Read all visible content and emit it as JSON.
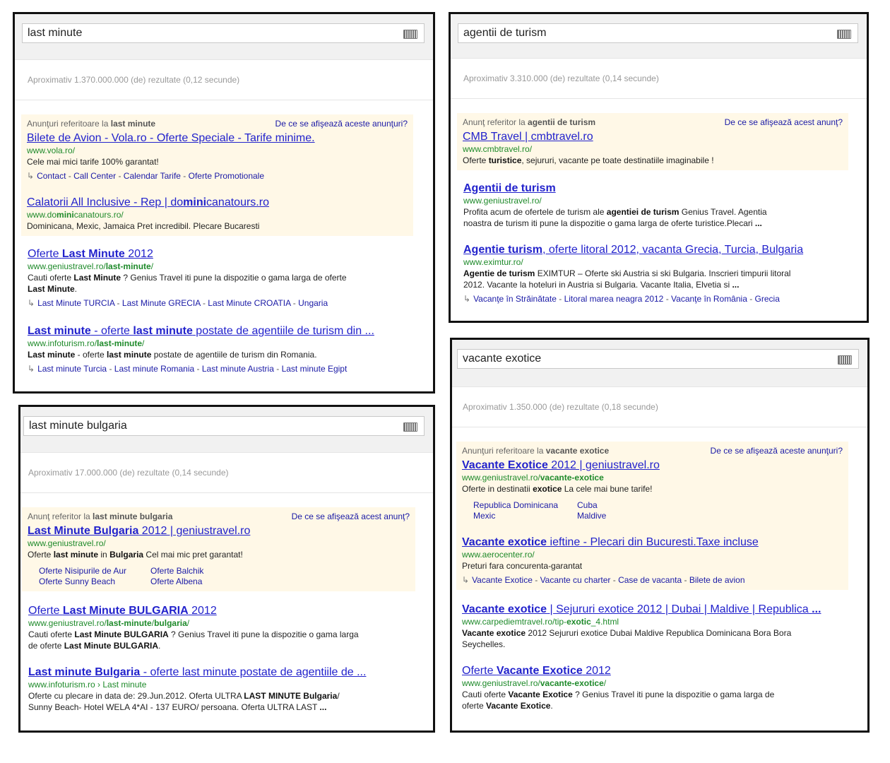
{
  "p1": {
    "query": "last minute",
    "stats": "Aproximativ 1.370.000.000 (de) rezultate (0,12 secunde)",
    "ad_head_prefix": "Anunţuri referitoare la ",
    "ad_head_bold": "last minute",
    "why": "De ce se afişează aceste anunţuri?",
    "ad1": {
      "title": "Bilete de Avion - Vola.ro - Oferte Speciale - Tarife minime.",
      "url": "www.vola.ro/",
      "snippet": "Cele mai mici tarife 100% garantat!",
      "links": [
        "Contact",
        "Call Center",
        "Calendar Tarife",
        "Oferte Promotionale"
      ]
    },
    "ad2": {
      "title_a": "Calatorii All Inclusive - Rep | do",
      "title_b": "mini",
      "title_c": "canatours.ro",
      "url_a": "www.do",
      "url_b": "mini",
      "url_c": "canatours.ro/",
      "snippet": "Dominicana, Mexic, Jamaica Pret incredibil. Plecare Bucaresti"
    },
    "r1": {
      "title_a": "Oferte ",
      "title_b": "Last Minute",
      "title_c": " 2012",
      "url_a": "www.geniustravel.ro/",
      "url_b": "last-minute",
      "url_c": "/",
      "snip_a": "Cauti oferte ",
      "snip_b": "Last Minute",
      "snip_c": " ? Genius Travel iti pune la dispozitie o gama larga de oferte",
      "snip_d": "Last Minute",
      "snip_e": ".",
      "links": [
        "Last Minute TURCIA",
        "Last Minute GRECIA",
        "Last Minute CROATIA",
        "Ungaria"
      ]
    },
    "r2": {
      "title_a": "Last minute",
      "title_b": " - oferte ",
      "title_c": "last minute",
      "title_d": " postate de agentiile de turism din ...",
      "url_a": "www.infoturism.ro/",
      "url_b": "last-minute",
      "url_c": "/",
      "snip_a": "Last minute",
      "snip_b": " - oferte ",
      "snip_c": "last minute",
      "snip_d": " postate de agentiile de turism din Romania.",
      "links": [
        "Last minute Turcia",
        "Last minute Romania",
        "Last minute Austria",
        "Last minute Egipt"
      ]
    }
  },
  "p2": {
    "query": "agentii de turism",
    "stats": "Aproximativ 3.310.000 (de) rezultate (0,14 secunde)",
    "ad_head_prefix": "Anunţ referitor la ",
    "ad_head_bold": "agentii de turism",
    "why": "De ce se afişează acest anunţ?",
    "ad1": {
      "title": "CMB Travel | cmbtravel.ro",
      "url": "www.cmbtravel.ro/",
      "snip_a": "Oferte ",
      "snip_b": "turistice",
      "snip_c": ", sejururi, vacante pe toate destinatiile imaginabile !"
    },
    "r1": {
      "title": "Agentii de turism",
      "url": "www.geniustravel.ro/",
      "snip_a": "Profita acum de ofertele de turism ale ",
      "snip_b": "agentiei de turism",
      "snip_c": " Genius Travel. Agentia",
      "snip_d": "noastra de turism iti pune la dispozitie o gama larga de oferte turistice.Plecari ",
      "snip_e": "..."
    },
    "r2": {
      "title_a": "Agentie turism",
      "title_b": ", oferte litoral 2012, vacanta Grecia, Turcia, Bulgaria",
      "url": "www.eximtur.ro/",
      "snip_a": "Agentie de turism",
      "snip_b": " EXIMTUR – Oferte ski Austria si ski Bulgaria. Inscrieri timpurii litoral",
      "snip_c": "2012. Vacante la hoteluri in Austria si Bulgaria. Vacante Italia, Elvetia si ",
      "snip_d": "...",
      "links": [
        "Vacanţe în Străinătate",
        "Litoral marea neagra 2012",
        "Vacanţe în România",
        "Grecia"
      ]
    }
  },
  "p3": {
    "query": "last minute bulgaria",
    "stats": "Aproximativ 17.000.000 (de) rezultate (0,14 secunde)",
    "ad_head_prefix": "Anunţ referitor la ",
    "ad_head_bold": "last minute bulgaria",
    "why": "De ce se afişează acest anunţ?",
    "ad1": {
      "title_a": "Last Minute Bulgaria",
      "title_b": " 2012 | geniustravel.ro",
      "url": "www.geniustravel.ro/",
      "snip_a": "Oferte ",
      "snip_b": "last minute",
      "snip_c": " in ",
      "snip_d": "Bulgaria",
      "snip_e": " Cel mai mic pret garantat!",
      "sitelinks": [
        "Oferte Nisipurile de Aur",
        "Oferte Balchik",
        "Oferte Sunny Beach",
        "Oferte Albena"
      ]
    },
    "r1": {
      "title_a": "Oferte ",
      "title_b": "Last Minute BULGARIA",
      "title_c": " 2012",
      "url_a": "www.geniustravel.ro/",
      "url_b": "last-minute",
      "url_c": "/",
      "url_d": "bulgaria",
      "url_e": "/",
      "snip_a": "Cauti oferte ",
      "snip_b": "Last Minute BULGARIA",
      "snip_c": " ? Genius Travel iti pune la dispozitie o gama larga",
      "snip_d": "de oferte ",
      "snip_e": "Last Minute BULGARIA",
      "snip_f": "."
    },
    "r2": {
      "title_a": "Last minute Bulgaria",
      "title_b": " - oferte last minute postate de agentiile de ...",
      "url": "www.infoturism.ro › Last minute",
      "snip_a": "Oferte cu plecare in data de: 29.Jun.2012. Oferta ULTRA ",
      "snip_b": "LAST MINUTE Bulgaria",
      "snip_c": "/",
      "snip_d": "Sunny Beach- Hotel WELA 4*AI - 137 EURO/ persoana. Oferta ULTRA LAST ",
      "snip_e": "..."
    }
  },
  "p4": {
    "query": "vacante exotice",
    "stats": "Aproximativ 1.350.000 (de) rezultate (0,18 secunde)",
    "ad_head_prefix": "Anunţuri referitoare la ",
    "ad_head_bold": "vacante exotice",
    "why": "De ce se afişează aceste anunţuri?",
    "ad1": {
      "title_a": "Vacante Exotice",
      "title_b": " 2012 | geniustravel.ro",
      "url_a": "www.geniustravel.ro/",
      "url_b": "vacante-exotice",
      "snip_a": "Oferte in destinatii ",
      "snip_b": "exotice",
      "snip_c": " La cele mai bune tarife!",
      "sitelinks": [
        "Republica Dominicana",
        "Cuba",
        "Mexic",
        "Maldive"
      ]
    },
    "ad2": {
      "title_a": "Vacante exotice",
      "title_b": " ieftine - Plecari din Bucuresti.Taxe incluse",
      "url": "www.aerocenter.ro/",
      "snippet": "Preturi fara concurenta-garantat",
      "links": [
        "Vacante Exotice",
        "Vacante cu charter",
        "Case de vacanta",
        "Bilete de avion"
      ]
    },
    "r1": {
      "title_a": "Vacante exotice",
      "title_b": " | Sejururi exotice 2012 | Dubai | Maldive | Republica ",
      "title_c": "...",
      "url_a": "www.carpediemtravel.ro/tip-",
      "url_b": "exotic",
      "url_c": "_4.html",
      "snip_a": "Vacante exotice",
      "snip_b": " 2012 Sejururi exotice Dubai Maldive Republica Dominicana Bora Bora",
      "snip_c": "Seychelles."
    },
    "r2": {
      "title_a": "Oferte ",
      "title_b": "Vacante Exotice",
      "title_c": " 2012",
      "url_a": "www.geniustravel.ro/",
      "url_b": "vacante-exotice",
      "url_c": "/",
      "snip_a": "Cauti oferte ",
      "snip_b": "Vacante Exotice",
      "snip_c": " ? Genius Travel iti pune la dispozitie o gama larga de",
      "snip_d": "oferte ",
      "snip_e": "Vacante Exotice",
      "snip_f": "."
    }
  },
  "icons": {
    "keyboard": "keyboard-icon",
    "sitelink_arrow": "sitelink-arrow-icon"
  },
  "link_separator": " - ",
  "arrow_glyph": "↳"
}
